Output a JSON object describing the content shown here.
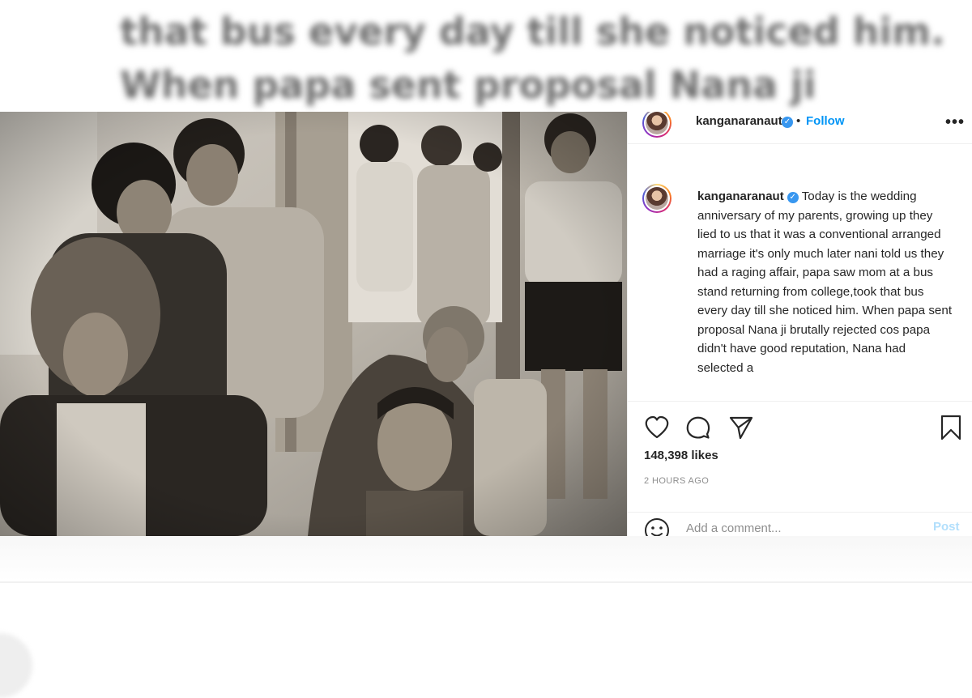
{
  "background": {
    "line_1": "that bus every day till she noticed him.",
    "line_2": "When papa sent proposal Nana ji"
  },
  "post": {
    "username": "kanganaranaut",
    "follow_label": "Follow",
    "separator": "•",
    "more_label": "•••",
    "verified_icon": "verified-badge-icon",
    "caption": "Today is the wedding anniversary of my parents, growing up they lied to us that it was a conventional arranged marriage it's only much later nani told us they had a raging affair, papa saw mom at a bus stand returning from college,took that bus every day till she noticed him. When papa sent proposal Nana ji brutally rejected cos papa didn't have good reputation, Nana had selected a",
    "likes": "148,398 likes",
    "time": "2 HOURS AGO",
    "comment_placeholder": "Add a comment...",
    "post_label": "Post",
    "icons": [
      "heart-icon",
      "comment-icon",
      "share-icon",
      "bookmark-icon",
      "emoji-icon"
    ],
    "colors": {
      "link": "#0095f6",
      "post_disabled": "#b2dffc",
      "verified": "#3897f0",
      "muted": "#8e8e8e"
    }
  }
}
